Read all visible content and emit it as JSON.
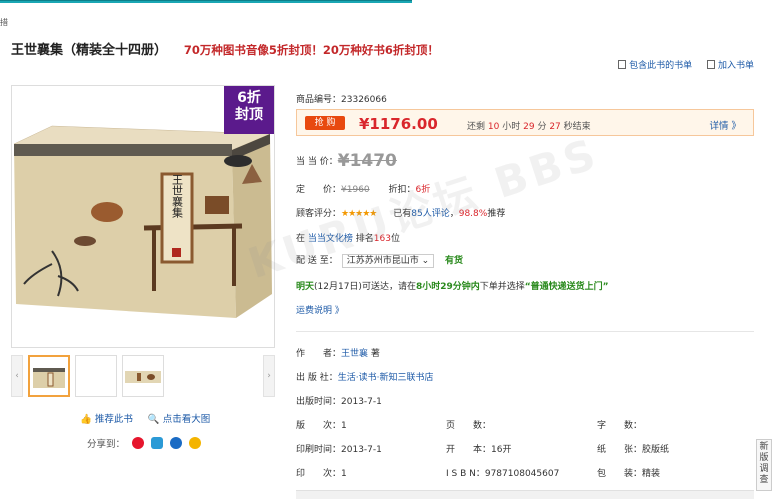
{
  "top_glyph": "措",
  "product": {
    "title": "王世襄集（精装全十四册）",
    "promo": "70万种图书音像5折封顶！20万种好书6折封顶！",
    "discount_badge_line1": "6折",
    "discount_badge_line2": "封顶",
    "book_cover_text": "王世襄集"
  },
  "links": {
    "booklist": "包含此书的书单",
    "add_booklist": "加入书单"
  },
  "info": {
    "item_no_label": "商品编号：",
    "item_no": "23326066",
    "flash_tag": "抢 购",
    "flash_price": "¥1176.00",
    "countdown_prefix": "还剩",
    "countdown_hours": "10",
    "hours_unit": "小时",
    "countdown_minutes": "29",
    "minutes_unit": "分",
    "countdown_seconds": "27",
    "seconds_suffix": "秒结束",
    "flash_detail": "详情 》",
    "dangdang_label": "当 当 价：",
    "dangdang_price": "¥1470",
    "list_label": "定　　价：",
    "list_price": "¥1960",
    "discount_label": "折扣：",
    "discount_value": "6折",
    "rating_label": "顾客评分：",
    "rating_stars": "★★★★★",
    "review_prefix": "已有",
    "review_count": "85人评论",
    "review_sep": "，",
    "recommend_rate": "98.8%",
    "recommend_suffix": "推荐",
    "rank_prefix": "在",
    "rank_list": "当当文化榜",
    "rank_mid": "排名",
    "rank_value": "163",
    "rank_suffix": "位",
    "delivery_label": "配 送 至：",
    "delivery_address": "江苏苏州市昆山市 ⌄",
    "stock": "有货",
    "eta_day": "明天",
    "eta_date": "(12月17日)可送达，请在",
    "eta_time": "8小时29分钟内",
    "eta_mid": "下单并选择",
    "eta_method": "“普通快递送货上门”",
    "shipping_note": "运费说明 》",
    "author_label": "作　　者：",
    "author": "王世襄",
    "author_suffix": "著",
    "publisher_label": "出 版 社：",
    "publisher": "生活·读书·新知三联书店",
    "pubdate_label": "出版时间：",
    "pubdate": "2013-7-1",
    "edition_label": "版　　次：",
    "edition": "1",
    "pages_label": "页　　数：",
    "pages": "",
    "words_label": "字　　数：",
    "words": "",
    "printdate_label": "印刷时间：",
    "printdate": "2013-7-1",
    "format_label": "开　　本：",
    "format": "16开",
    "paper_label": "纸　　张：",
    "paper": "胶版纸",
    "printing_label": "印　　次：",
    "printing": "1",
    "isbn_label": "I S B N：",
    "isbn": "9787108045607",
    "binding_label": "包　　装：",
    "binding": "精装"
  },
  "actions": {
    "recommend": "推荐此书",
    "zoom": "点击看大图",
    "share_label": "分享到："
  },
  "survey": "新版调查",
  "watermark": "KURU论坛 BBS"
}
